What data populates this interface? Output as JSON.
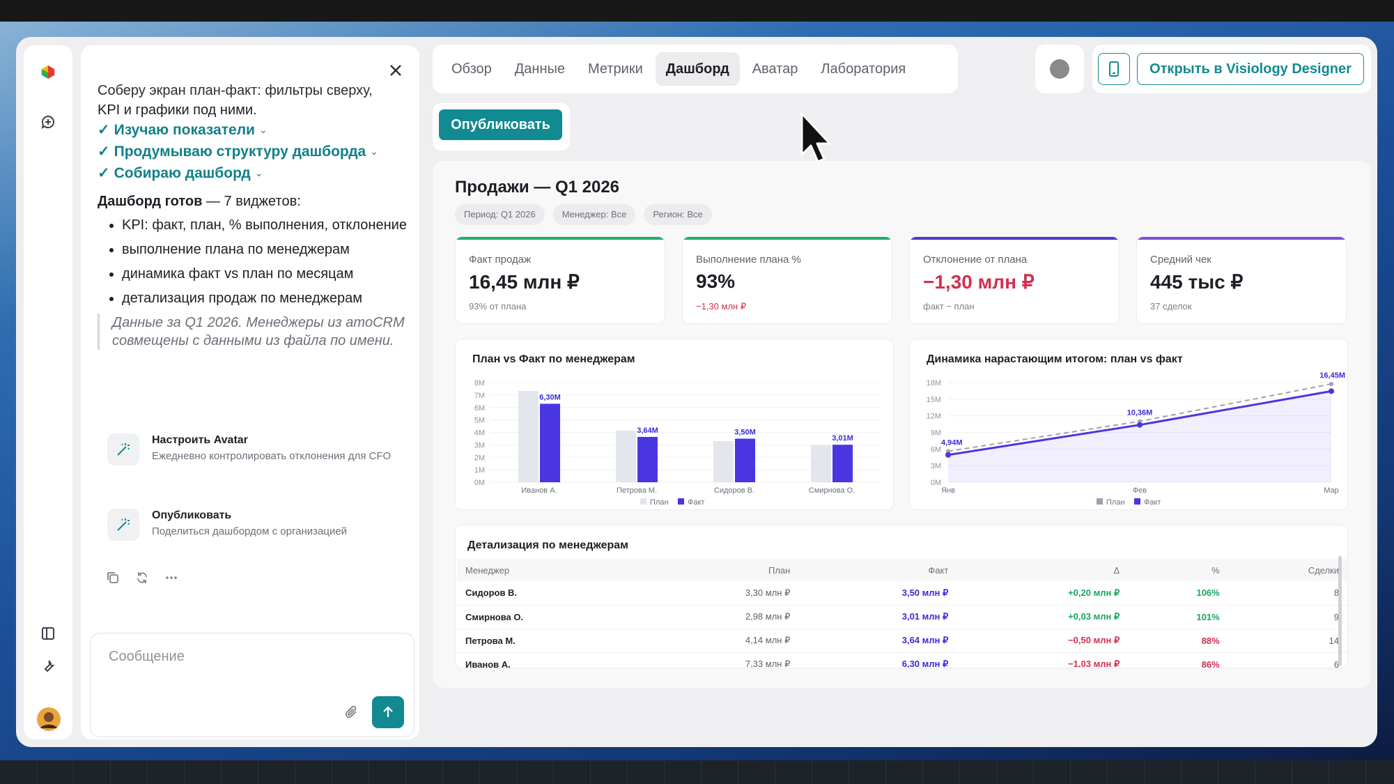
{
  "chat": {
    "intro_cut": "Соберу экран план-факт: фильтры сверху,",
    "intro_rest": "KPI и графики под ними.",
    "steps": [
      "Изучаю показатели",
      "Продумываю структуру дашборда",
      "Собираю дашборд"
    ],
    "ready_bold": "Дашборд готов",
    "ready_rest": " — 7 виджетов:",
    "bullets": [
      "KPI: факт, план, % выполнения, отклонение",
      "выполнение плана по менеджерам",
      "динамика факт vs план по месяцам",
      "детализация продаж по менеджерам"
    ],
    "note": "Данные за Q1 2026. Менеджеры из amoCRM совмещены с данными из файла по имени.",
    "suggestions": [
      {
        "title": "Настроить Avatar",
        "desc": "Ежедневно контролировать отклонения для CFO"
      },
      {
        "title": "Опубликовать",
        "desc": "Поделиться дашбордом с организацией"
      }
    ],
    "composer_placeholder": "Сообщение"
  },
  "tabs": [
    "Обзор",
    "Данные",
    "Метрики",
    "Дашборд",
    "Аватар",
    "Лаборатория"
  ],
  "active_tab": "Дашборд",
  "open_button": "Открыть в Visiology Designer",
  "publish_button": "Опубликовать",
  "dashboard": {
    "title": "Продажи — Q1 2026",
    "filters": [
      "Период: Q1 2026",
      "Менеджер: Все",
      "Регион: Все"
    ],
    "kpis": [
      {
        "label": "Факт продаж",
        "value": "16,45 млн ₽",
        "sub": "93% от плана",
        "color": "#1fae6a",
        "value_color": "#1c1f24",
        "sub_color": "#7b8088"
      },
      {
        "label": "Выполнение плана %",
        "value": "93%",
        "sub": "−1,30 млн ₽",
        "color": "#1fae6a",
        "value_color": "#1c1f24",
        "sub_color": "#d1304f"
      },
      {
        "label": "Отклонение от плана",
        "value": "−1,30 млн ₽",
        "sub": "факт − план",
        "color": "#4b3bc8",
        "value_color": "#d1304f",
        "sub_color": "#7b8088"
      },
      {
        "label": "Средний чек",
        "value": "445 тыс ₽",
        "sub": "37 сделок",
        "color": "#7d4fd8",
        "value_color": "#1c1f24",
        "sub_color": "#7b8088"
      }
    ],
    "table": {
      "title": "Детализация по менеджерам",
      "columns": [
        "Менеджер",
        "План",
        "Факт",
        "Δ",
        "%",
        "Сделки"
      ],
      "rows": [
        [
          "Сидоров В.",
          "3,30 млн ₽",
          "3,50 млн ₽",
          "+0,20 млн ₽",
          "106%",
          "8"
        ],
        [
          "Смирнова О.",
          "2,98 млн ₽",
          "3,01 млн ₽",
          "+0,03 млн ₽",
          "101%",
          "9"
        ],
        [
          "Петрова М.",
          "4,14 млн ₽",
          "3,64 млн ₽",
          "−0,50 млн ₽",
          "88%",
          "14"
        ],
        [
          "Иванов А.",
          "7,33 млн ₽",
          "6,30 млн ₽",
          "−1,03 млн ₽",
          "86%",
          "6"
        ]
      ]
    }
  },
  "chart_data": [
    {
      "type": "bar",
      "title": "План vs Факт по менеджерам",
      "categories": [
        "Иванов А.",
        "Петрова М.",
        "Сидоров В.",
        "Смирнова О."
      ],
      "series": [
        {
          "name": "План",
          "values": [
            7.33,
            4.14,
            3.3,
            2.98
          ],
          "color": "#e4e6ee"
        },
        {
          "name": "Факт",
          "values": [
            6.3,
            3.64,
            3.5,
            3.01
          ],
          "color": "#4a36e0"
        }
      ],
      "data_labels": [
        "6,30M",
        "3,64M",
        "3,50M",
        "3,01M"
      ],
      "yticks": [
        "0M",
        "1M",
        "2M",
        "3M",
        "4M",
        "5M",
        "6M",
        "7M",
        "8M"
      ],
      "ylim": [
        0,
        8
      ],
      "legend": "bottom",
      "grid": true
    },
    {
      "type": "line",
      "title": "Динамика нарастающим итогом: план vs факт",
      "x": [
        "Янв",
        "Фев",
        "Мар"
      ],
      "series": [
        {
          "name": "План",
          "values": [
            5.6,
            11.0,
            17.75
          ],
          "color": "#9ea2ab",
          "dashed": true
        },
        {
          "name": "Факт",
          "values": [
            4.94,
            10.36,
            16.45
          ],
          "color": "#4a36e0"
        }
      ],
      "data_labels": [
        "4,94M",
        "10,36M",
        "16,45M"
      ],
      "yticks": [
        "0M",
        "3M",
        "6M",
        "9M",
        "12M",
        "15M",
        "18M"
      ],
      "ylim": [
        0,
        18
      ],
      "legend": "bottom",
      "grid": true
    }
  ]
}
